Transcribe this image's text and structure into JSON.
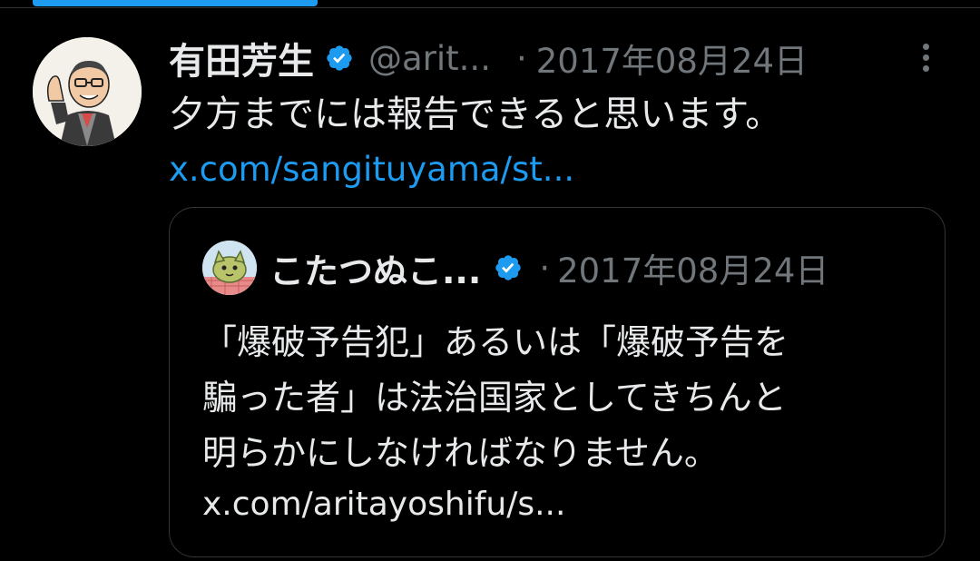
{
  "colors": {
    "background": "#000000",
    "text_primary": "#e7e9ea",
    "text_secondary": "#71767b",
    "accent": "#1d9bf0",
    "border": "#333639"
  },
  "tweet": {
    "display_name": "有田芳生",
    "verified_icon": "verified-badge-icon",
    "handle": "@arit...",
    "separator": "·",
    "timestamp": "2017年08月24日",
    "more_icon": "more-options-icon",
    "text": "夕方までには報告できると思います。",
    "link": "x.com/sangituyama/st..."
  },
  "quote": {
    "display_name": "こたつぬこ...",
    "verified_icon": "verified-badge-icon",
    "separator": "·",
    "timestamp": "2017年08月24日",
    "text_lines": [
      "「爆破予告犯」あるいは「爆破予告を",
      "騙った者」は法治国家としてきちんと",
      "明らかにしなければなりません。"
    ],
    "link": "x.com/aritayoshifu/s..."
  }
}
